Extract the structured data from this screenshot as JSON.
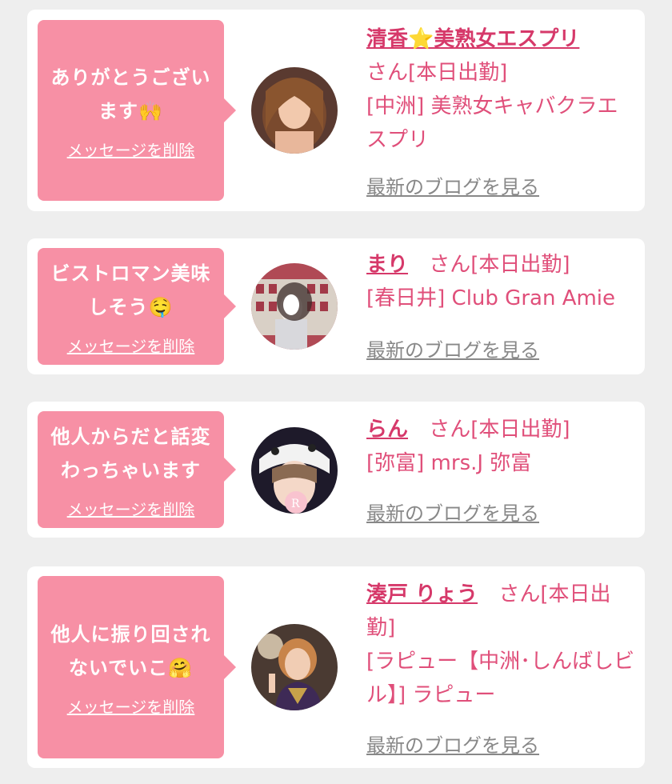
{
  "cards": [
    {
      "message_line1": "ありがとうござい",
      "message_line2": "ます🙌",
      "delete_label": "メッセージを削除",
      "name": "清香⭐美熟女エスプリ",
      "suffix": "さん[本日出勤]",
      "shop": "[中洲] 美熟女キャバクラエスプリ",
      "blog_label": "最新のブログを見る"
    },
    {
      "message_line1": "ビストロマン美味",
      "message_line2": "しそう🤤",
      "delete_label": "メッセージを削除",
      "name": "まり",
      "suffix": "さん[本日出勤]",
      "shop": "[春日井] Club Gran Amie",
      "blog_label": "最新のブログを見る"
    },
    {
      "message_line1": "他人からだと話変",
      "message_line2": "わっちゃいます",
      "delete_label": "メッセージを削除",
      "name": "らん",
      "suffix": "さん[本日出勤]",
      "shop": "[弥富] mrs.J 弥富",
      "blog_label": "最新のブログを見る"
    },
    {
      "message_line1": "他人に振り回され",
      "message_line2": "ないでいこ🤗",
      "delete_label": "メッセージを削除",
      "name": "湊戸 りょう",
      "suffix": "さん[本日出勤]",
      "shop": "[ラピュー【中洲･しんばしビル】] ラピュー",
      "blog_label": "最新のブログを見る"
    }
  ],
  "colors": {
    "bubble": "#f790a5",
    "accent": "#d6396a",
    "link_gray": "#888888"
  }
}
